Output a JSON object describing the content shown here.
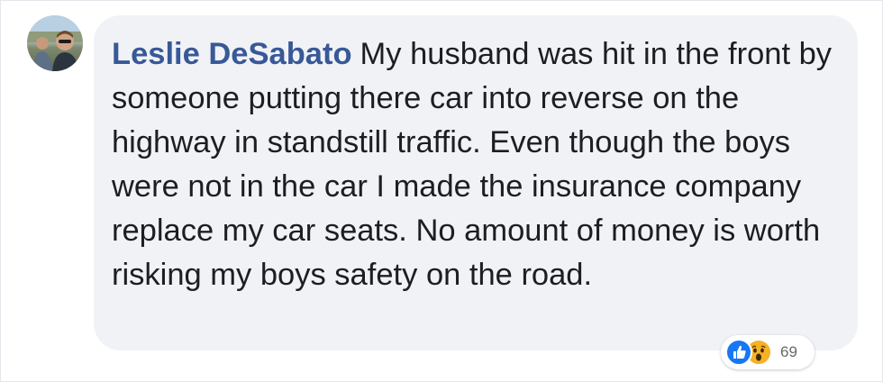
{
  "comment": {
    "author": "Leslie DeSabato",
    "text": "My husband was hit in the front by someone putting there car into reverse on the highway in standstill traffic. Even though the boys were not in the car I made the insurance company replace my car seats. No amount of money is worth risking my boys safety on the road."
  },
  "reactions": {
    "icons": [
      "thumbs-up-icon",
      "wow-face-icon"
    ],
    "count": "69"
  },
  "colors": {
    "author_link": "#385898",
    "bubble_bg": "#f0f2f5",
    "body_text": "#1c1e21",
    "like_blue": "#1877f2",
    "wow_yellow": "#f7b125",
    "count_gray": "#65676b"
  }
}
